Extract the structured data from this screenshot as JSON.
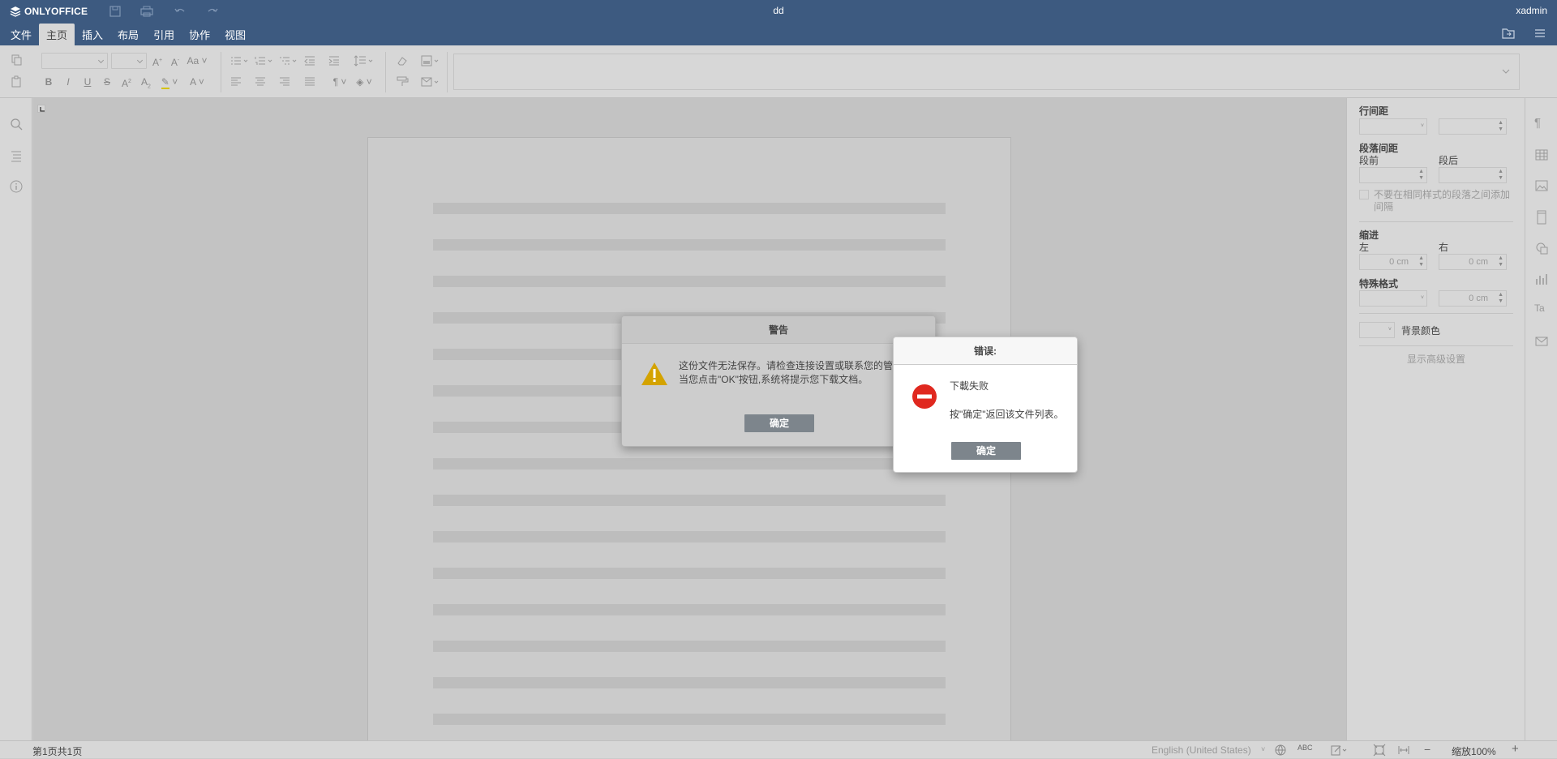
{
  "app": {
    "logo_text": "ONLYOFFICE",
    "document_title": "dd",
    "user_name": "xadmin"
  },
  "tabs": [
    {
      "label": "文件"
    },
    {
      "label": "主页",
      "active": true
    },
    {
      "label": "插入"
    },
    {
      "label": "布局"
    },
    {
      "label": "引用"
    },
    {
      "label": "协作"
    },
    {
      "label": "视图"
    }
  ],
  "right_panel": {
    "line_spacing_label": "行间距",
    "paragraph_spacing_label": "段落间距",
    "before_label": "段前",
    "after_label": "段后",
    "no_space_checkbox_label": "不要在相同样式的段落之间添加间隔",
    "indent_label": "缩进",
    "left_label": "左",
    "right_label": "右",
    "left_value": "0 cm",
    "right_value": "0 cm",
    "special_format_label": "特殊格式",
    "special_value": "0 cm",
    "background_color_label": "背景颜色",
    "advanced_settings_link": "显示高级设置"
  },
  "warning_dialog": {
    "title": "警告",
    "line1": "这份文件无法保存。请检查连接设置或联系您的管",
    "line2": "当您点击\"OK\"按钮,系统将提示您下载文档。",
    "ok_label": "确定"
  },
  "error_dialog": {
    "title": "错误:",
    "line1": "下載失败",
    "line2": "按\"确定\"返回该文件列表。",
    "ok_label": "确定"
  },
  "status_bar": {
    "page_info": "第1页共1页",
    "language": "English (United States)",
    "zoom_label": "缩放100%"
  },
  "colors": {
    "header": "#3d5a80",
    "toolbar": "#d7d7d7",
    "button": "#7d858c",
    "error_icon": "#e0281f",
    "warning_icon": "#d4a300"
  }
}
